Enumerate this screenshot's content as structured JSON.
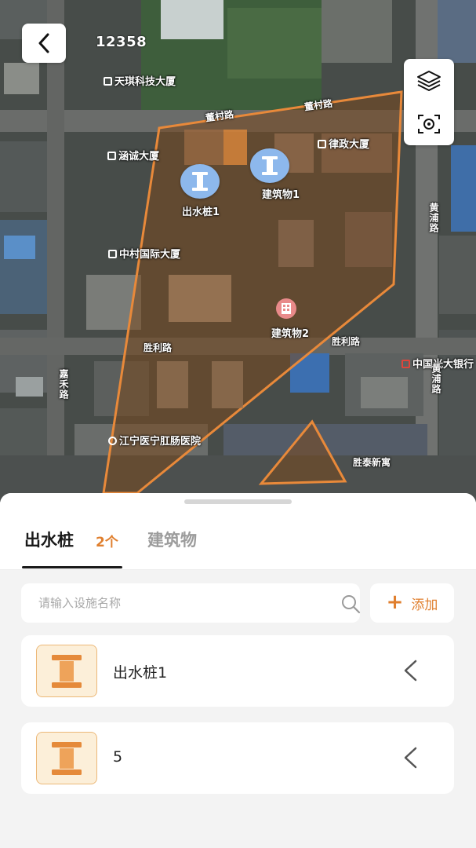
{
  "header": {
    "map_id": "12358"
  },
  "map": {
    "poi_labels": [
      "天琪科技大厦",
      "涵诚大厦",
      "律政大厦",
      "中村国际大厦",
      "中国光大银行",
      "江宁医宁肛肠医院",
      "胜泰新寓"
    ],
    "road_labels": [
      "董村路",
      "董村路",
      "胜利路",
      "胜利路",
      "黄浦路",
      "黄浦路",
      "嘉禾路"
    ],
    "markers": [
      {
        "label": "出水桩1",
        "icon": "pile-icon"
      },
      {
        "label": "建筑物1",
        "icon": "pile-icon"
      },
      {
        "label": "建筑物2",
        "icon": "building-icon"
      }
    ],
    "boundary_color": "#e8893a"
  },
  "sheet": {
    "tabs": [
      {
        "label": "出水桩",
        "count": "2个",
        "active": true
      },
      {
        "label": "建筑物",
        "active": false
      }
    ],
    "search": {
      "placeholder": "请输入设施名称",
      "value": ""
    },
    "add_label": "添加",
    "items": [
      {
        "name": "出水桩1",
        "icon": "water-pile-icon"
      },
      {
        "name": "5",
        "icon": "water-pile-icon"
      }
    ],
    "accent_color": "#e07f2e"
  }
}
